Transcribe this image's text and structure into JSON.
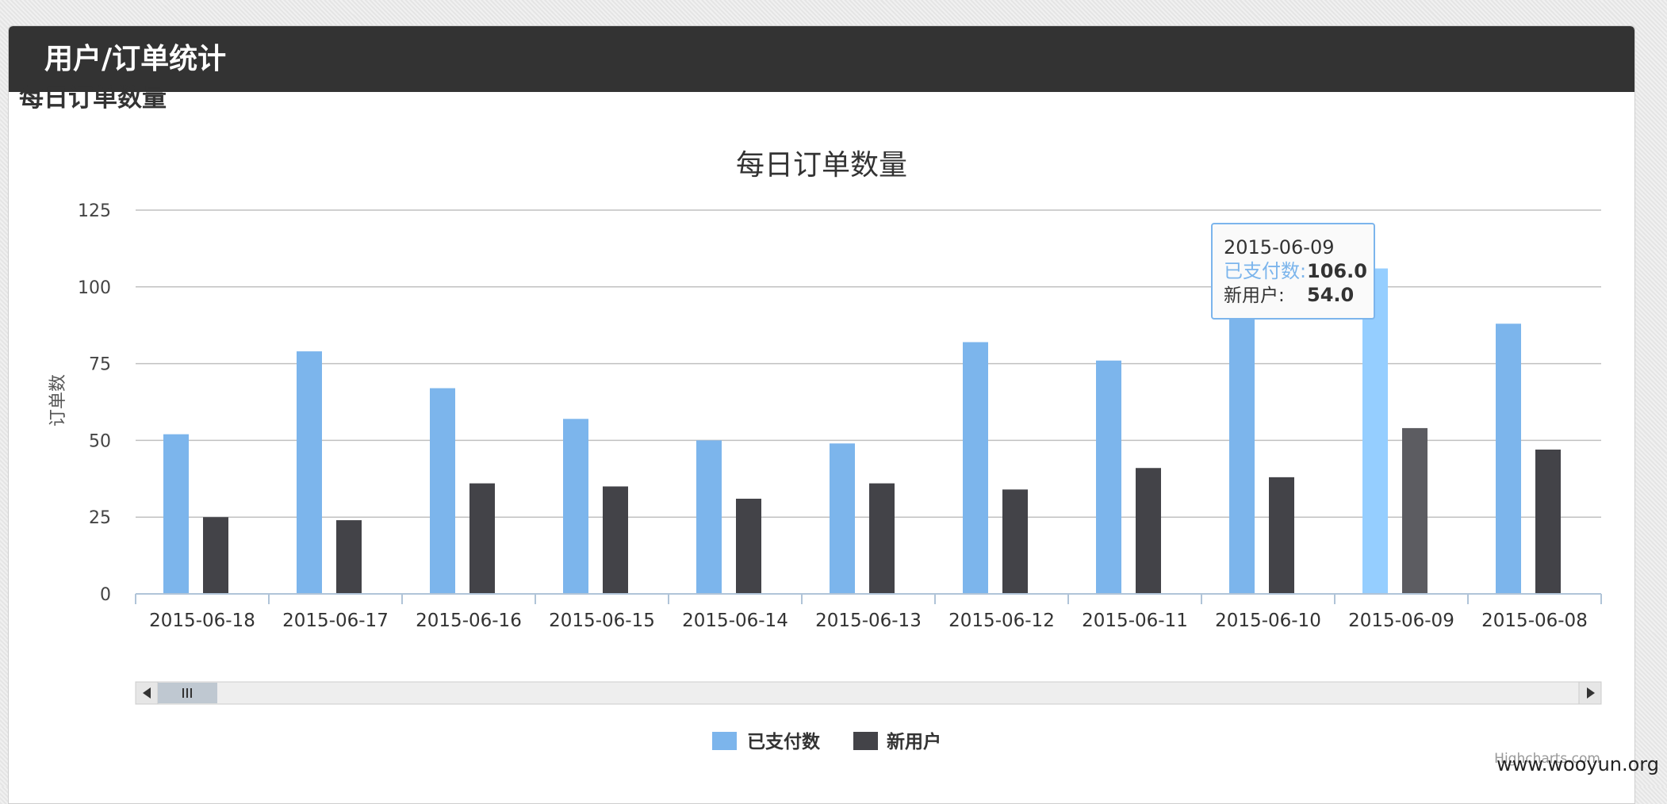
{
  "panel": {
    "title": "用户/订单统计"
  },
  "section": {
    "title": "每日订单数量"
  },
  "colors": {
    "paid": "#7cb5ec",
    "paid_hover": "#95ceff",
    "new": "#434348",
    "new_hover": "#5c5c61"
  },
  "chart_data": {
    "type": "bar",
    "title": "每日订单数量",
    "ylabel": "订单数",
    "xlabel": "",
    "ylim": [
      0,
      125
    ],
    "yticks": [
      0,
      25,
      50,
      75,
      100,
      125
    ],
    "categories": [
      "2015-06-18",
      "2015-06-17",
      "2015-06-16",
      "2015-06-15",
      "2015-06-14",
      "2015-06-13",
      "2015-06-12",
      "2015-06-11",
      "2015-06-10",
      "2015-06-09",
      "2015-06-08"
    ],
    "series": [
      {
        "name": "已支付数",
        "values": [
          52,
          79,
          67,
          57,
          50,
          49,
          82,
          76,
          96,
          106,
          88
        ]
      },
      {
        "name": "新用户",
        "values": [
          25,
          24,
          36,
          35,
          31,
          36,
          34,
          41,
          38,
          54,
          47
        ]
      }
    ],
    "grid": true,
    "legend": "bottom-center",
    "highlighted_category": "2015-06-09"
  },
  "tooltip": {
    "date": "2015-06-09",
    "paid_label": "已支付数:",
    "paid_value": "106.0",
    "new_label": "新用户:",
    "new_value": "54.0"
  },
  "scrollbar": {
    "thumb_icon": "grip-icon",
    "left_icon": "arrow-left-icon",
    "right_icon": "arrow-right-icon"
  },
  "credits": "Highcharts.com",
  "watermark": "www.wooyun.org"
}
